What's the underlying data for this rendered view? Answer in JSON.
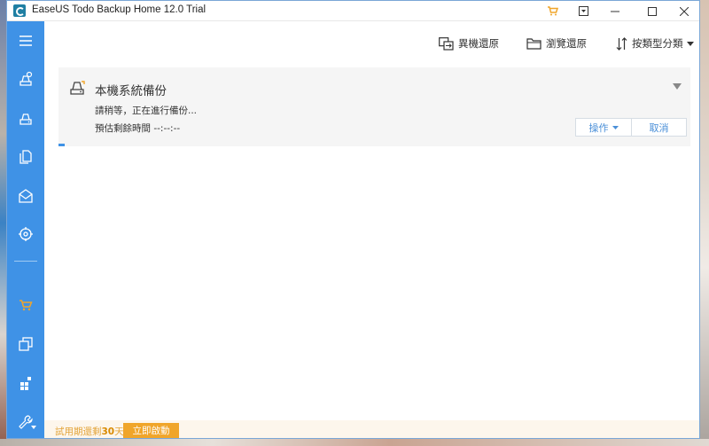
{
  "window": {
    "title": "EaseUS Todo Backup Home 12.0 Trial"
  },
  "toolbar": {
    "remote_restore": "異機還原",
    "browse_restore": "瀏覽還原",
    "sort_label": "按類型分類"
  },
  "task": {
    "title": "本機系統備份",
    "status": "請稍等，正在進行備份...",
    "remaining_label": "預估剩餘時間",
    "remaining_value": "--:--:--",
    "progress_fraction": 0.01,
    "actions_label": "操作",
    "cancel_label": "取消"
  },
  "footer": {
    "trial_prefix": "試用期還剩",
    "trial_days": "30",
    "trial_suffix": "天",
    "activate_label": "立即啟動"
  },
  "colors": {
    "sidebar": "#3f92e6",
    "accent": "#4a8fd8",
    "trial": "#f0a52a"
  },
  "icons": {
    "menu": "hamburger-icon",
    "system_backup": "disk-backup-icon",
    "disk_backup": "disk-icon",
    "file_backup": "files-icon",
    "mail_backup": "mail-icon",
    "smart_backup": "target-icon",
    "cart": "cart-icon",
    "clone": "clone-icon",
    "apps": "apps-icon",
    "tools": "wrench-icon"
  }
}
